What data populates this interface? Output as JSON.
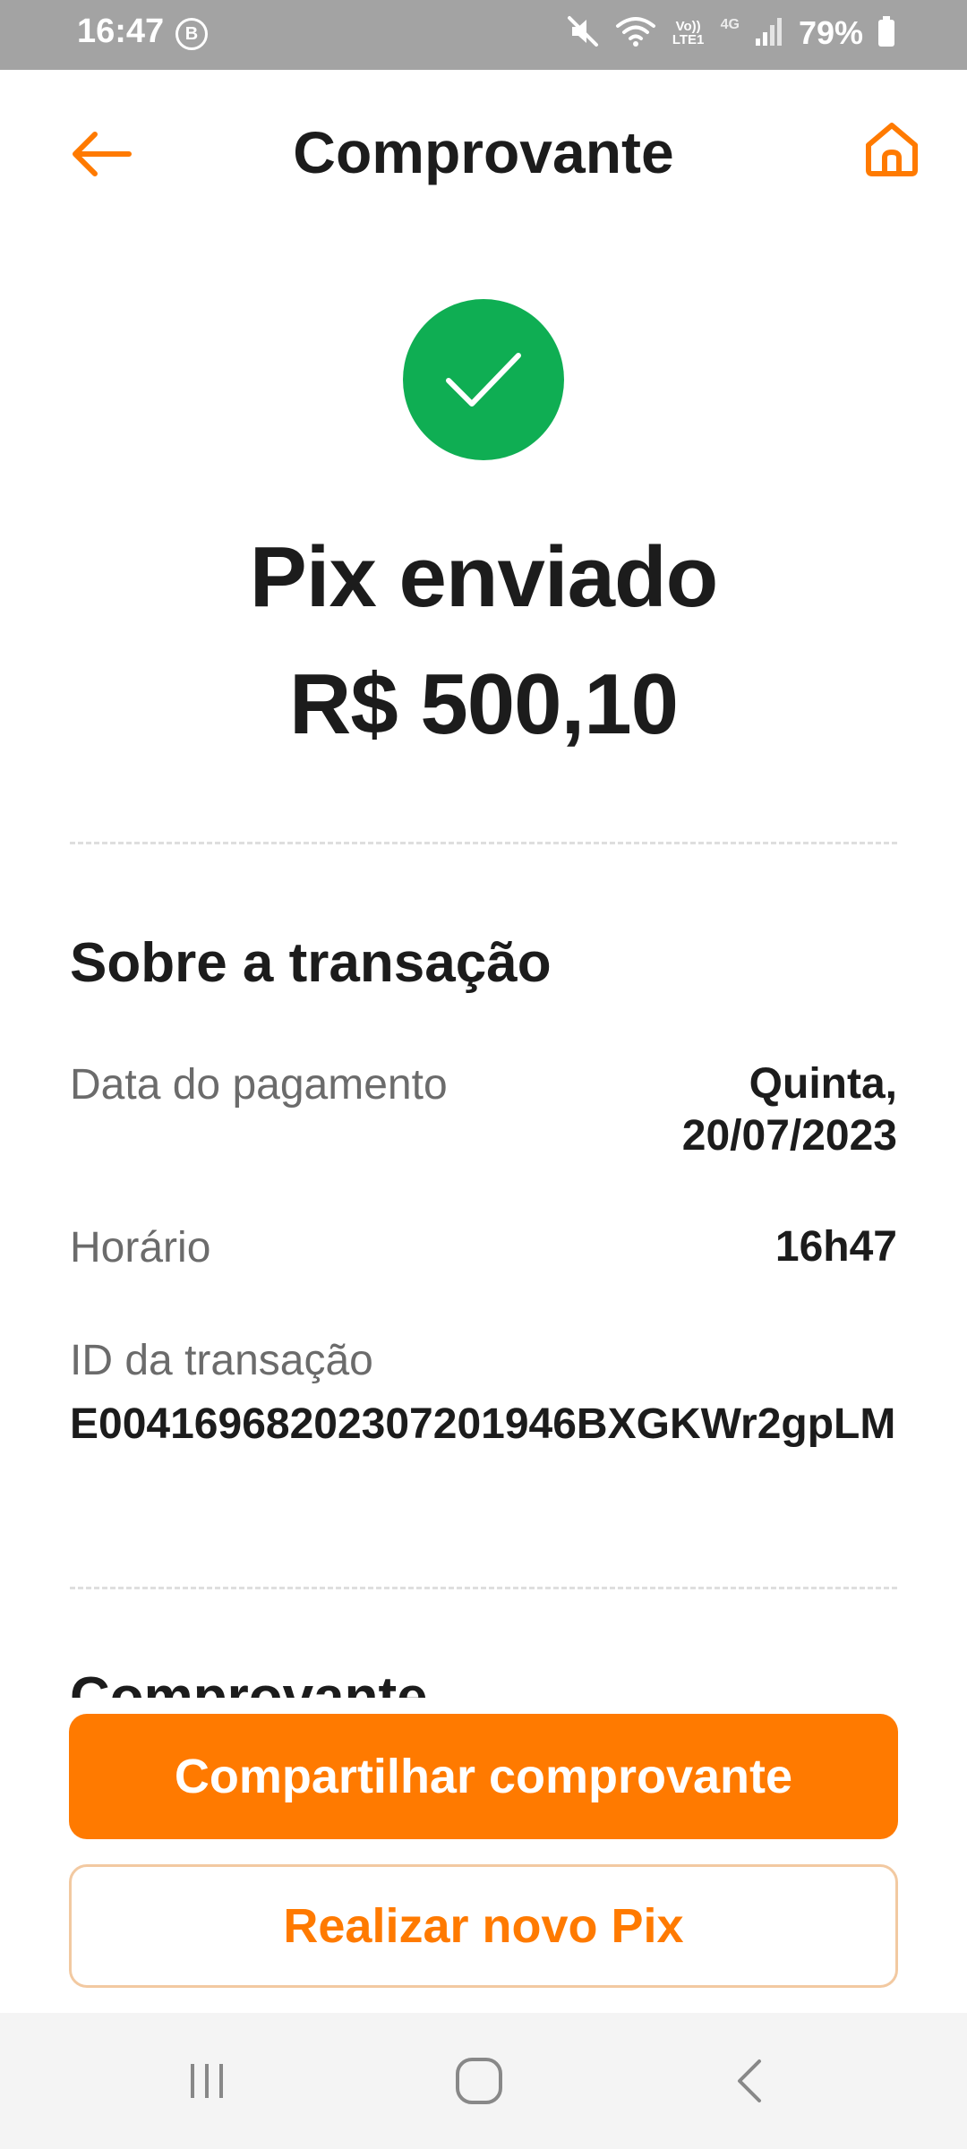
{
  "status_bar": {
    "time": "16:47",
    "b_badge": "B",
    "volte_label": "Vo)) LTE1",
    "network": "4G",
    "battery": "79%"
  },
  "header": {
    "title": "Comprovante",
    "back_icon": "arrow-left-icon",
    "home_icon": "home-icon"
  },
  "success": {
    "icon": "check-icon",
    "title": "Pix enviado",
    "amount": "R$ 500,10"
  },
  "transaction": {
    "section_title": "Sobre a transação",
    "date_label": "Data do pagamento",
    "date_value_line1": "Quinta,",
    "date_value_line2": "20/07/2023",
    "time_label": "Horário",
    "time_value": "16h47",
    "id_label": "ID da transação",
    "id_value": "E00416968202307201946BXGKWr2gpLM"
  },
  "next_section_title_partial": "Comprovante",
  "actions": {
    "share_label": "Compartilhar comprovante",
    "new_pix_label": "Realizar novo Pix"
  },
  "colors": {
    "accent": "#ff7a00",
    "success": "#0fae53",
    "status_bar": "#a3a3a3",
    "secondary_border": "#f2c9a1"
  }
}
